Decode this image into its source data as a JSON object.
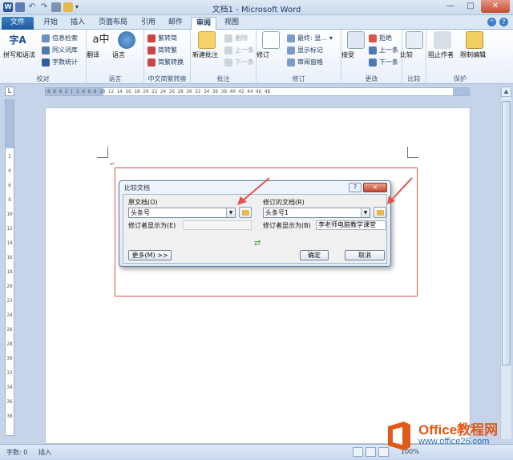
{
  "app": {
    "title": "文档1 - Microsoft Word"
  },
  "tabs": [
    {
      "label": "文件"
    },
    {
      "label": "开始"
    },
    {
      "label": "插入"
    },
    {
      "label": "页面布局"
    },
    {
      "label": "引用"
    },
    {
      "label": "邮件"
    },
    {
      "label": "审阅"
    },
    {
      "label": "视图"
    }
  ],
  "ribbon": {
    "proofing": {
      "label": "校对",
      "spelling": "拼写和语法",
      "research": "信息检索",
      "thesaurus": "同义词库",
      "wordcount": "字数统计"
    },
    "language": {
      "label": "语言",
      "translate": "翻译",
      "language": "语言"
    },
    "chinese": {
      "label": "中文简繁转换",
      "to_simplified": "繁转简",
      "to_traditional": "简转繁",
      "convert": "简繁转换"
    },
    "comments": {
      "label": "批注",
      "new": "新建批注",
      "delete": "删除",
      "prev": "上一条",
      "next": "下一条"
    },
    "tracking": {
      "label": "修订",
      "track": "修订",
      "display": "最终: 显...",
      "show_markup": "显示标记",
      "pane": "审阅窗格"
    },
    "changes": {
      "label": "更改",
      "accept": "接受",
      "reject": "拒绝",
      "prev": "上一条",
      "next": "下一条"
    },
    "compare": {
      "label": "比较",
      "compare": "比较"
    },
    "protect": {
      "label": "保护",
      "block_authors": "阻止作者",
      "restrict": "限制编辑"
    }
  },
  "ruler": {
    "ticks": "8  6  4  2  |  2  4  6  8  10  12  14  16  18  20  22  24  26  28  30  32  34  36  38  40  42  44  46  48",
    "vticks": [
      "2",
      "4",
      "6",
      "8",
      "10",
      "12",
      "14",
      "16",
      "18",
      "20",
      "22",
      "24",
      "26",
      "28",
      "30",
      "32",
      "34",
      "36",
      "38"
    ]
  },
  "dialog": {
    "title": "比较文档",
    "help": "?",
    "close": "×",
    "original_label": "原文档(O)",
    "original_value": "头条号",
    "original_author_label": "修订者显示为(E)",
    "original_author_value": "",
    "revised_label": "修订的文档(R)",
    "revised_value": "头条号1",
    "revised_author_label": "修订者显示为(B)",
    "revised_author_value": "李老师电脑教学课堂",
    "swap": "⇄",
    "more": "更多(M) >>",
    "ok": "确定",
    "cancel": "取消"
  },
  "document": {
    "para_mark": "↵"
  },
  "status": {
    "words": "字数: 0",
    "insert": "插入",
    "zoom": "100%"
  },
  "watermark": {
    "line1": "Office教程网",
    "line2": "www.office26.com"
  },
  "colors": {
    "accent": "#2b579a",
    "annotation_red": "#e0534f",
    "watermark_orange": "#e05a1a",
    "watermark_blue": "#2c6fb7"
  }
}
